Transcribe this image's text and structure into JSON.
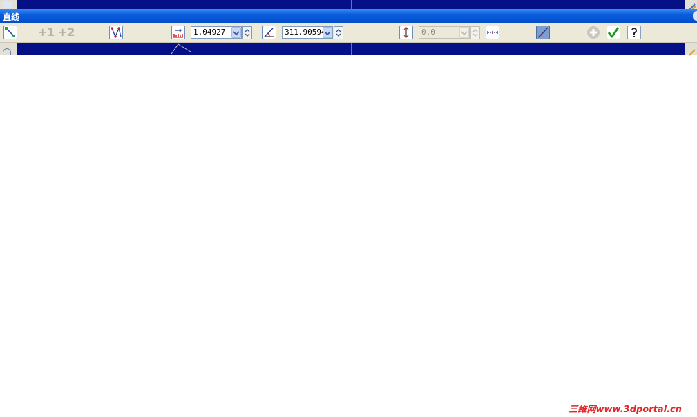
{
  "window": {
    "title": "直线"
  },
  "toolbar": {
    "plus1_label": "+1",
    "plus2_label": "+2",
    "length_value": "1.04927",
    "angle_value": "311.90594",
    "offset_value": "0.0"
  },
  "watermark": "三维网www.3dportal.cn",
  "colors": {
    "viewport_bg": "#050f86",
    "titlebar": "#0a5ddb",
    "toolbar_bg": "#ece9d8",
    "watermark": "#e1262a"
  }
}
